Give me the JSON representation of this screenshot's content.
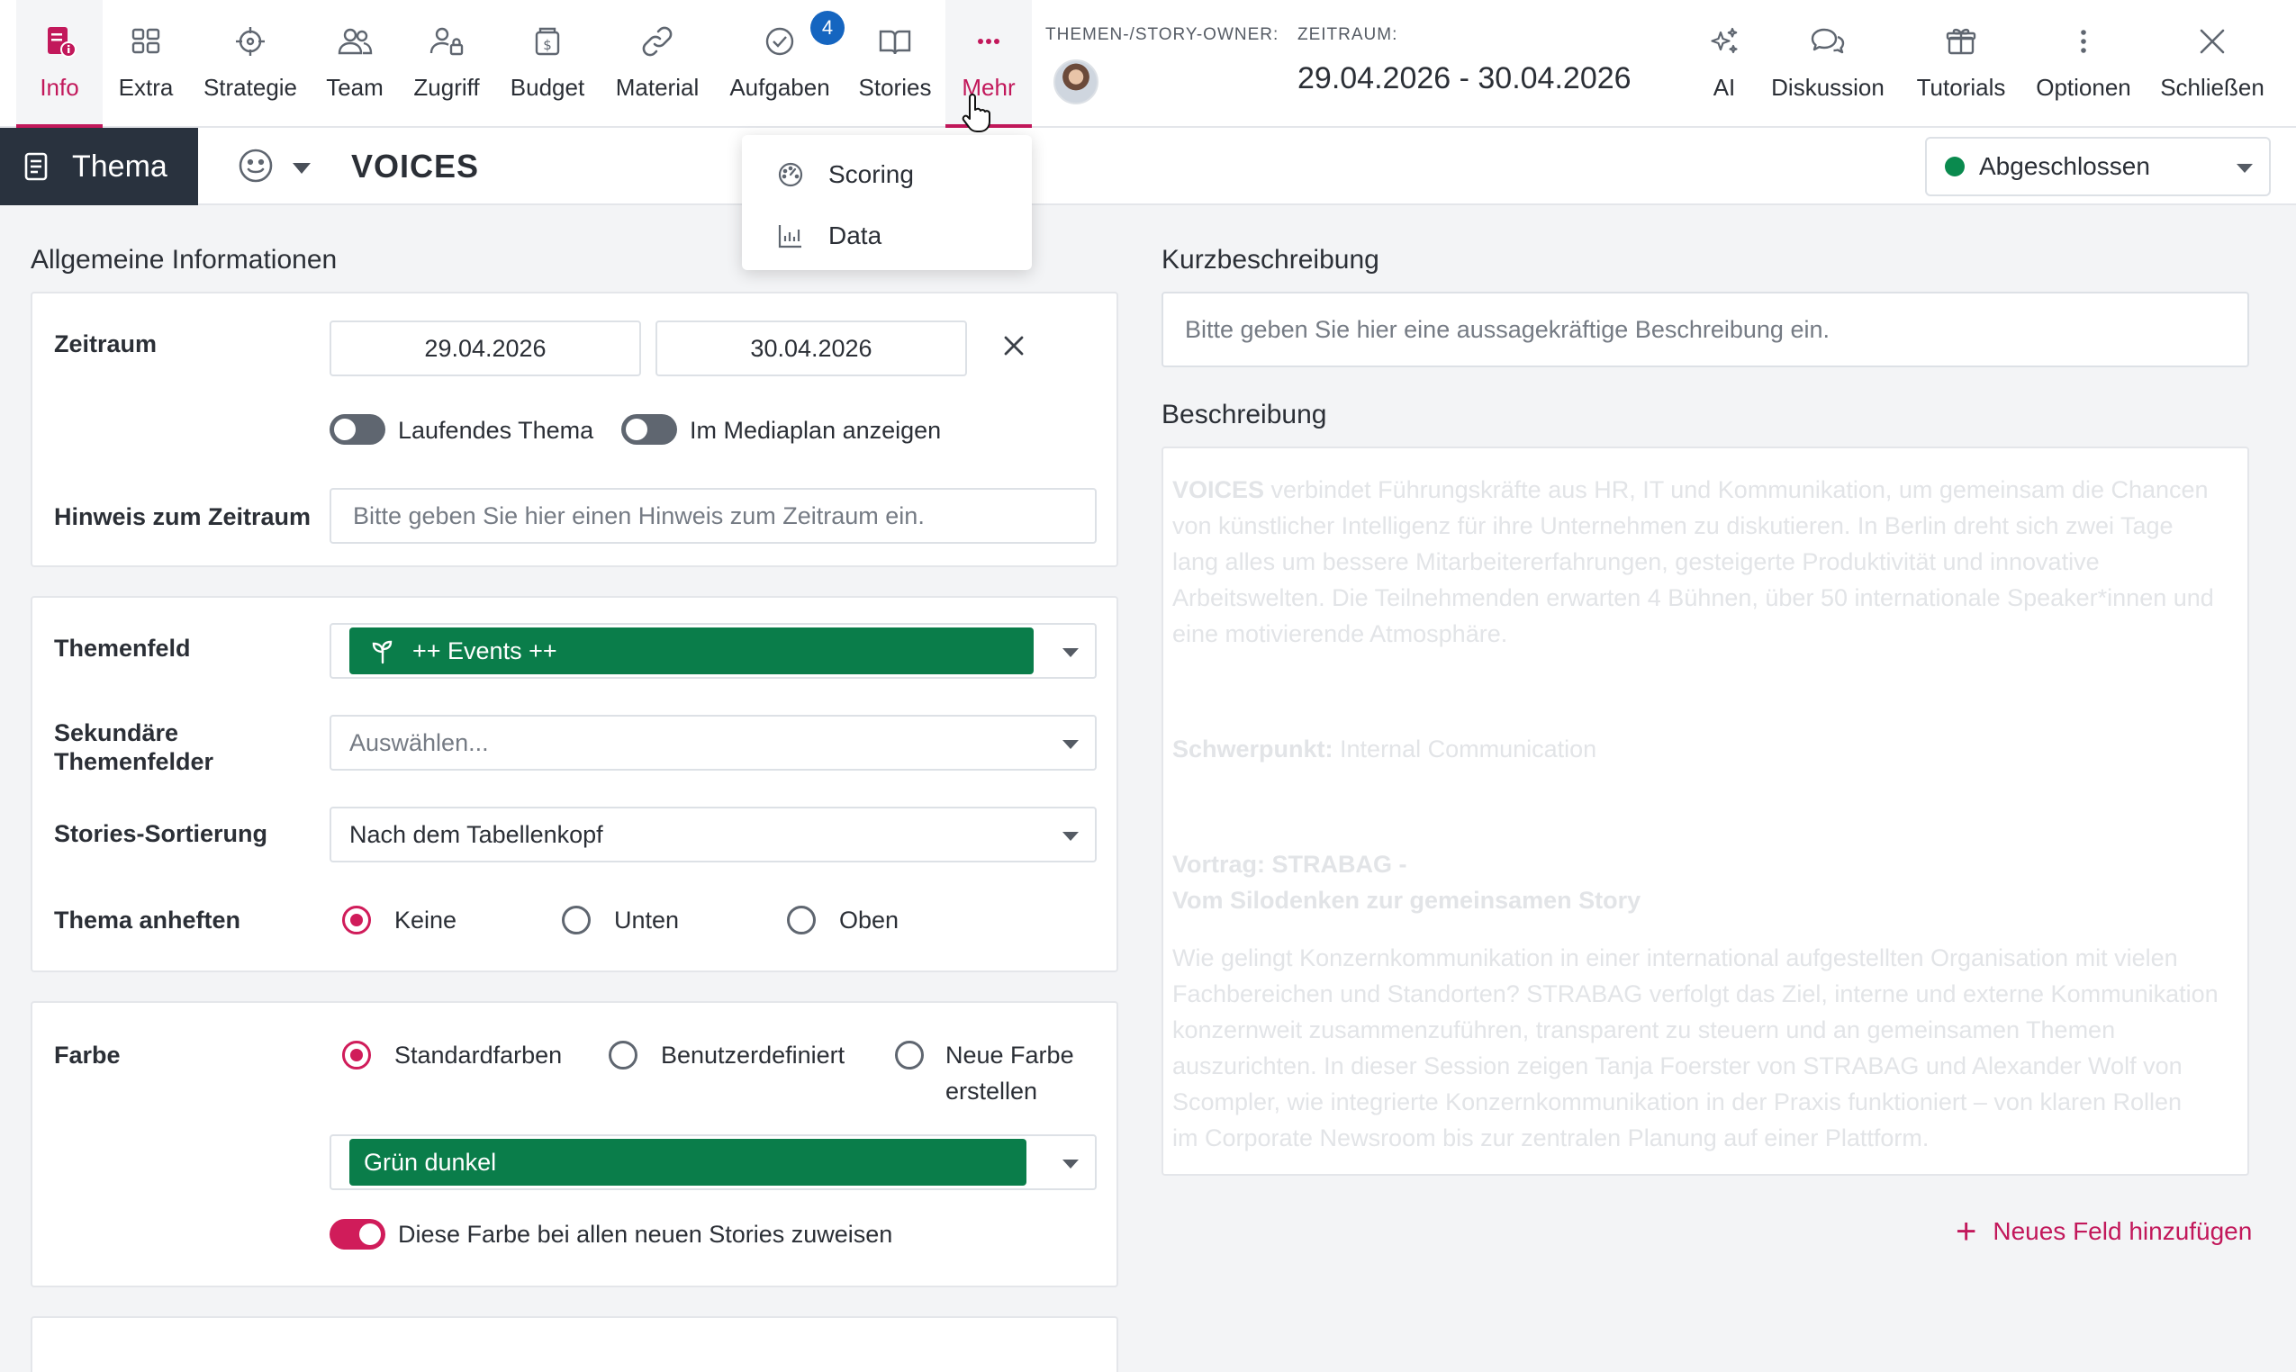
{
  "nav": {
    "items": [
      {
        "label": "Info",
        "icon": "document-info-icon"
      },
      {
        "label": "Extra",
        "icon": "grid-list-icon"
      },
      {
        "label": "Strategie",
        "icon": "crosshair-icon"
      },
      {
        "label": "Team",
        "icon": "people-icon"
      },
      {
        "label": "Zugriff",
        "icon": "user-lock-icon"
      },
      {
        "label": "Budget",
        "icon": "dollar-box-icon"
      },
      {
        "label": "Material",
        "icon": "link-icon"
      },
      {
        "label": "Aufgaben",
        "icon": "check-circle-icon",
        "badge": "4"
      },
      {
        "label": "Stories",
        "icon": "book-open-icon"
      },
      {
        "label": "Mehr",
        "icon": "more-horizontal-icon"
      }
    ],
    "owner_label": "THEMEN-/STORY-OWNER:",
    "period_label": "ZEITRAUM:",
    "period_value": "29.04.2026 - 30.04.2026",
    "right_items": [
      {
        "label": "AI",
        "icon": "sparkle-icon"
      },
      {
        "label": "Diskussion",
        "icon": "chat-bubbles-icon"
      },
      {
        "label": "Tutorials",
        "icon": "gift-box-icon"
      },
      {
        "label": "Optionen",
        "icon": "vertical-dots-icon"
      },
      {
        "label": "Schließen",
        "icon": "close-icon"
      }
    ]
  },
  "subbar": {
    "tab_label": "Thema",
    "title": "VOICES",
    "status": "Abgeschlossen",
    "status_color": "#0a8a4e"
  },
  "dropdown": {
    "items": [
      {
        "label": "Scoring",
        "icon": "gauge-icon"
      },
      {
        "label": "Data",
        "icon": "bar-chart-icon"
      }
    ]
  },
  "general": {
    "section_title": "Allgemeine Informationen",
    "zeitraum_label": "Zeitraum",
    "start_date": "29.04.2026",
    "end_date": "30.04.2026",
    "toggle_running": "Laufendes Thema",
    "toggle_mediaplan": "Im Mediaplan anzeigen",
    "hint_label": "Hinweis zum Zeitraum",
    "hint_placeholder": "Bitte geben Sie hier einen Hinweis zum Zeitraum ein."
  },
  "topic": {
    "field_label": "Themenfeld",
    "field_value": "++ Events ++",
    "secondary_label_1": "Sekundäre",
    "secondary_label_2": "Themenfelder",
    "secondary_placeholder": "Auswählen...",
    "sorting_label": "Stories-Sortierung",
    "sorting_value": "Nach dem Tabellenkopf",
    "pin_label": "Thema anheften",
    "pin_options": [
      "Keine",
      "Unten",
      "Oben"
    ],
    "pin_selected": "Keine"
  },
  "color": {
    "label": "Farbe",
    "options": [
      "Standardfarben",
      "Benutzerdefiniert",
      "Neue Farbe",
      "erstellen"
    ],
    "selected_color_name": "Grün dunkel",
    "selected_color_hex": "#0a7d4a",
    "assign_toggle": "Diese Farbe bei allen neuen Stories zuweisen"
  },
  "right": {
    "short_title": "Kurzbeschreibung",
    "short_placeholder": "Bitte geben Sie hier eine aussagekräftige Beschreibung ein.",
    "desc_title": "Beschreibung",
    "desc": {
      "p1_bold": "VOICES",
      "p1_lines": [
        " verbindet Führungskräfte aus HR, IT und Kommunikation, um gemeinsam die Chancen",
        "von künstlicher Intelligenz für ihre Unternehmen zu diskutieren. In Berlin dreht sich zwei Tage",
        "lang alles um bessere Mitarbeitererfahrungen, gesteigerte Produktivität und innovative",
        "Arbeitswelten. Die Teilnehmenden erwarten 4 Bühnen, über 50 internationale Speaker*innen und",
        "eine motivierende Atmosphäre."
      ],
      "p2_bold": "Schwerpunkt:",
      "p2_text": " Internal Communication",
      "p3_bold_1": "Vortrag: STRABAG -",
      "p3_bold_2": "Vom Silodenken zur gemeinsamen Story",
      "p4_lines": [
        "Wie gelingt Konzernkommunikation in einer international aufgestellten Organisation mit vielen",
        "Fachbereichen und Standorten? STRABAG verfolgt das Ziel, interne und externe Kommunikation",
        "konzernweit zusammenzuführen, transparent zu steuern und an gemeinsamen Themen",
        "auszurichten. In dieser Session zeigen Tanja Foerster von STRABAG und Alexander Wolf von",
        "Scompler, wie integrierte Konzernkommunikation in der Praxis funktioniert – von klaren Rollen",
        "im Corporate Newsroom bis zur zentralen Planung auf einer Plattform."
      ]
    },
    "add_field": "Neues Feld hinzufügen"
  }
}
